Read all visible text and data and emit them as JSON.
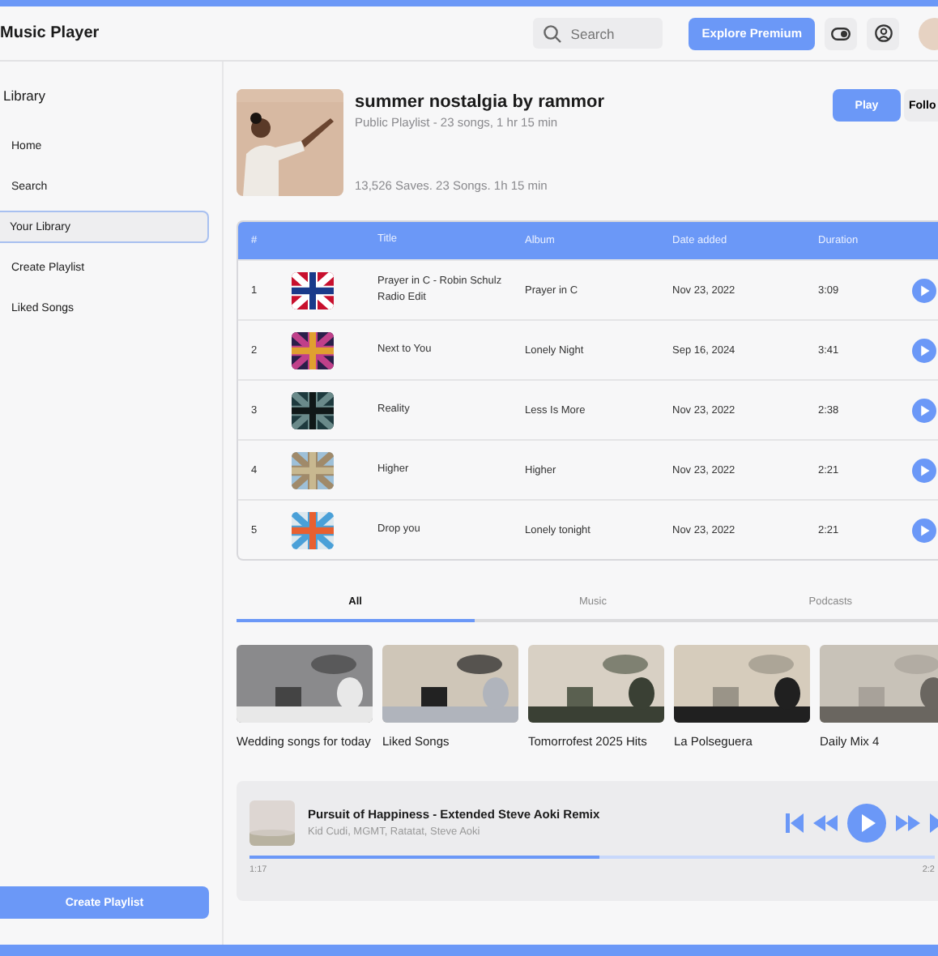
{
  "header": {
    "title": "Music Player",
    "search": {
      "placeholder": "Search"
    },
    "premium_button": "Explore Premium"
  },
  "sidebar": {
    "heading": "Library",
    "items": [
      {
        "label": "Home",
        "selected": false
      },
      {
        "label": "Search",
        "selected": false
      },
      {
        "label": "Your Library",
        "selected": true
      },
      {
        "label": "Create Playlist",
        "selected": false
      },
      {
        "label": "Liked Songs",
        "selected": false
      }
    ],
    "create_button": "Create Playlist"
  },
  "playlist": {
    "title": "summer nostalgia by rammor",
    "subtitle": "Public Playlist - 23 songs, 1 hr 15 min",
    "stats": "13,526 Saves. 23 Songs. 1h 15 min",
    "play_button": "Play",
    "follow_button": "Follo"
  },
  "table": {
    "columns": [
      "#",
      "Title",
      "Album",
      "Date added",
      "Duration"
    ],
    "rows": [
      {
        "number": "1",
        "title": "Prayer in C - Robin Schulz Radio Edit",
        "album": "Prayer in C",
        "date_added": "Nov 23, 2022",
        "duration": "3:09"
      },
      {
        "number": "2",
        "title": "Next to You",
        "album": "Lonely Night",
        "date_added": "Sep 16, 2024",
        "duration": "3:41"
      },
      {
        "number": "3",
        "title": "Reality",
        "album": "Less Is More",
        "date_added": "Nov 23, 2022",
        "duration": "2:38"
      },
      {
        "number": "4",
        "title": "Higher",
        "album": "Higher",
        "date_added": "Nov 23, 2022",
        "duration": "2:21"
      },
      {
        "number": "5",
        "title": "Drop you",
        "album": "Lonely tonight",
        "date_added": "Nov 23, 2022",
        "duration": "2:21"
      }
    ]
  },
  "tabs": [
    {
      "label": "All",
      "selected": true
    },
    {
      "label": "Music",
      "selected": false
    },
    {
      "label": "Podcasts",
      "selected": false
    }
  ],
  "cards": [
    {
      "title": "Wedding songs for today"
    },
    {
      "title": "Liked Songs"
    },
    {
      "title": "Tomorrofest 2025 Hits"
    },
    {
      "title": "La Polseguera"
    },
    {
      "title": "Daily Mix 4"
    }
  ],
  "now_playing": {
    "title": "Pursuit of Happiness - Extended Steve Aoki Remix",
    "artists": "Kid Cudi, MGMT, Ratatat, Steve Aoki",
    "level": 0.51,
    "elapsed": "1:17",
    "total": "2:2"
  }
}
